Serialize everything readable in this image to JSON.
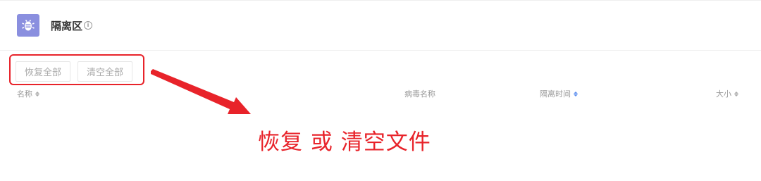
{
  "header": {
    "title": "隔离区",
    "info_icon": "info-icon",
    "app_icon": "bug-icon",
    "app_icon_color": "#8a8fdf"
  },
  "toolbar": {
    "restore_all": "恢复全部",
    "clear_all": "清空全部"
  },
  "table": {
    "columns": [
      {
        "label": "名称",
        "sortable": true,
        "active": false
      },
      {
        "label": "病毒名称",
        "sortable": false,
        "active": false
      },
      {
        "label": "隔离时间",
        "sortable": true,
        "active": true
      },
      {
        "label": "大小",
        "sortable": true,
        "active": false
      }
    ],
    "rows": []
  },
  "annotation": {
    "text": "恢复 或 清空文件",
    "color": "#e8232a"
  }
}
